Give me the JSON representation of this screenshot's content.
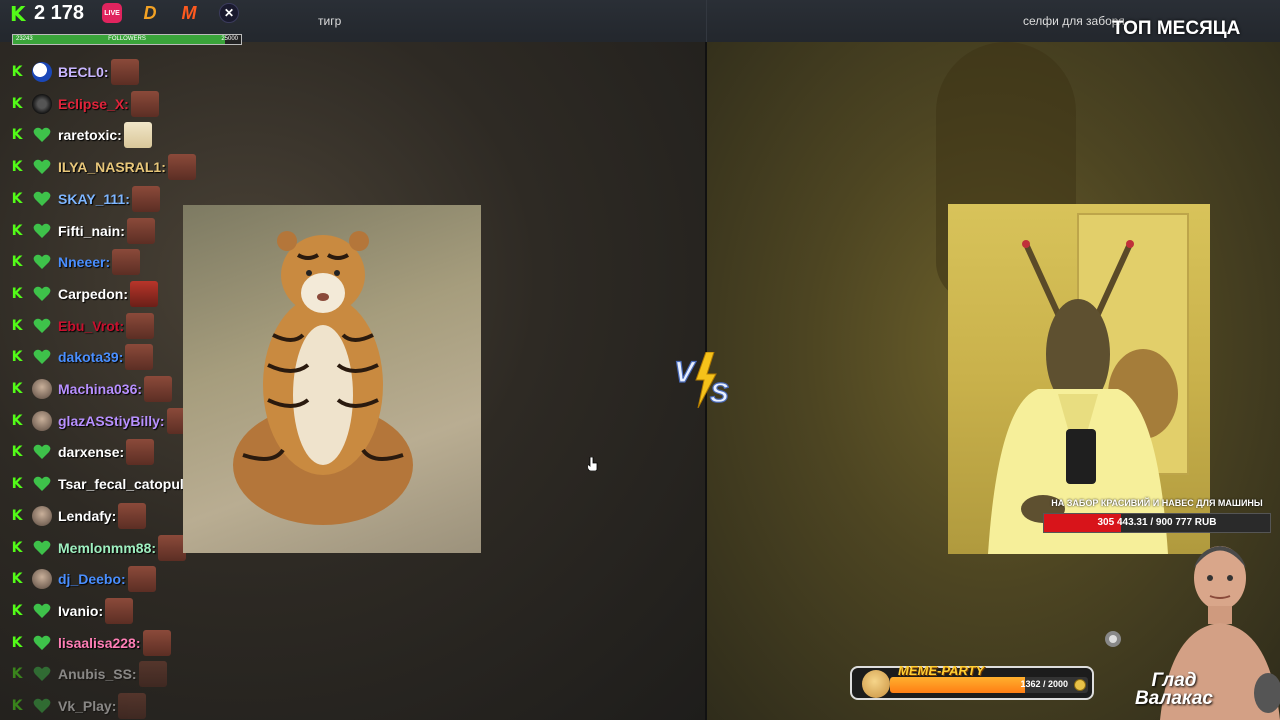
{
  "header": {
    "viewer_count": "2 178",
    "platforms": [
      "live-icon",
      "d-icon",
      "m-icon",
      "x-icon"
    ],
    "live_badge": "LIVE",
    "followers_bar": {
      "current": "23243",
      "label": "FOLLOWERS",
      "goal": "25000",
      "progress": 0.93
    },
    "left_title": "тигр",
    "right_title": "селфи для заборя",
    "top_label": "ТОП МЕСЯЦА"
  },
  "chat": {
    "users": [
      {
        "name": "BECL0:",
        "color": "#c9b6ff",
        "avatar": "circle-logo",
        "emote": "face"
      },
      {
        "name": "Eclipse_X:",
        "color": "#e0233a",
        "avatar": "dark-circle",
        "emote": "face"
      },
      {
        "name": "raretoxic:",
        "color": "#ffffff",
        "avatar": "heart",
        "emote": "blonde"
      },
      {
        "name": "ILYA_NASRAL1:",
        "color": "#e8c77a",
        "avatar": "heart",
        "emote": "face"
      },
      {
        "name": "SKAY_111:",
        "color": "#7eb6ff",
        "avatar": "heart",
        "emote": "face"
      },
      {
        "name": "Fifti_nain:",
        "color": "#ffffff",
        "avatar": "heart",
        "emote": "face"
      },
      {
        "name": "Nneeer:",
        "color": "#4a8fff",
        "avatar": "heart",
        "emote": "face"
      },
      {
        "name": "Carpedon:",
        "color": "#ffffff",
        "avatar": "heart",
        "emote": "red"
      },
      {
        "name": "Ebu_Vrot:",
        "color": "#c8102e",
        "avatar": "heart",
        "emote": "face"
      },
      {
        "name": "dakota39:",
        "color": "#4a8fff",
        "avatar": "heart",
        "emote": "face"
      },
      {
        "name": "Machina036:",
        "color": "#b890ff",
        "avatar": "photo",
        "emote": "face"
      },
      {
        "name": "glazASStiyBilly:",
        "color": "#b890ff",
        "avatar": "photo",
        "emote": "face"
      },
      {
        "name": "darxense:",
        "color": "#ffffff",
        "avatar": "heart",
        "emote": "face"
      },
      {
        "name": "Tsar_fecal_catopult:",
        "color": "#ffffff",
        "avatar": "heart",
        "emote": "grey"
      },
      {
        "name": "Lendafy:",
        "color": "#ffffff",
        "avatar": "photo",
        "emote": "face"
      },
      {
        "name": "Memlonmm88:",
        "color": "#9ff0c0",
        "avatar": "heart",
        "emote": "face"
      },
      {
        "name": "dj_Deebo:",
        "color": "#4a8fff",
        "avatar": "photo",
        "emote": "face"
      },
      {
        "name": "Ivanio:",
        "color": "#ffffff",
        "avatar": "heart",
        "emote": "face"
      },
      {
        "name": "lisaalisa228:",
        "color": "#ff7eb6",
        "avatar": "heart",
        "emote": "face"
      },
      {
        "name": "Anubis_SS:",
        "color": "#ffffff",
        "avatar": "heart",
        "emote": "face",
        "faded": true
      },
      {
        "name": "Vk_Play:",
        "color": "#ffffff",
        "avatar": "heart",
        "emote": "face",
        "faded": true
      }
    ]
  },
  "vs_label": "VS",
  "goal": {
    "title": "НА ЗАБОР КРАСИВИЙ И НАВЕС ДЛЯ МАШИНЫ",
    "text": "305 443.31 / 900 777 RUB",
    "progress": 0.339
  },
  "meme_party": {
    "label": "MEME-PARTY",
    "count": "1362 / 2000",
    "progress": 0.681
  },
  "streamer": {
    "name_line1": "Глад",
    "name_line2": "Валакас"
  },
  "colors": {
    "kick_green": "#53fc18",
    "goal_red": "#d8141a"
  }
}
